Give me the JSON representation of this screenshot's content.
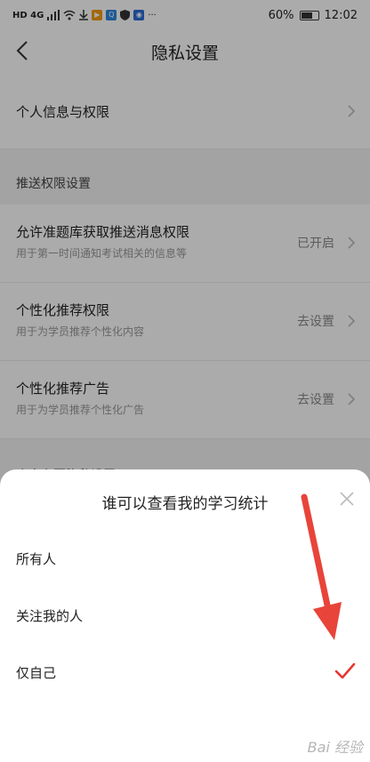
{
  "status_bar": {
    "network": "HD 4G",
    "battery": "60%",
    "time": "12:02",
    "overflow": "···"
  },
  "nav": {
    "title": "隐私设置"
  },
  "settings": {
    "personal_info": "个人信息与权限",
    "push_section": "推送权限设置",
    "push_permission": {
      "title": "允许准题库获取推送消息权限",
      "subtitle": "用于第一时间通知考试相关的信息等",
      "value": "已开启"
    },
    "personalized_rec": {
      "title": "个性化推荐权限",
      "subtitle": "用于为学员推荐个性化内容",
      "value": "去设置"
    },
    "personalized_ads": {
      "title": "个性化推荐广告",
      "subtitle": "用于为学员推荐个性化广告",
      "value": "去设置"
    },
    "homepage_section": "个人主页隐私设置"
  },
  "sheet": {
    "title": "谁可以查看我的学习统计",
    "options": [
      "所有人",
      "关注我的人",
      "仅自己"
    ],
    "selected_index": 2
  },
  "colors": {
    "accent_red": "#e53935",
    "arrow_red": "#e8443a"
  },
  "watermark": "Bai 经验"
}
